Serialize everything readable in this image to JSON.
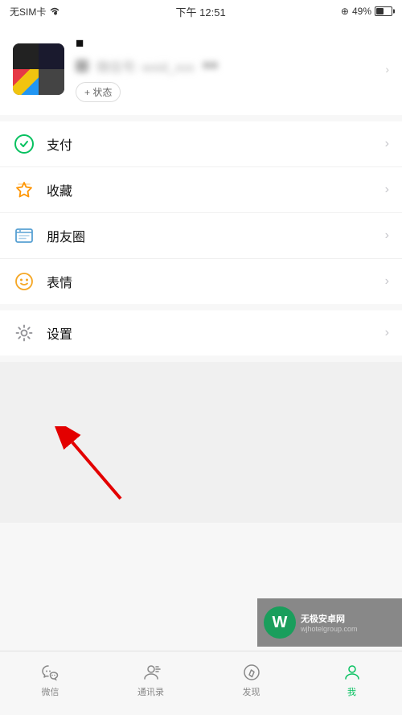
{
  "statusBar": {
    "left": "无SIM卡",
    "wifi": "wifi",
    "time": "下午 12:51",
    "lock": "⊕",
    "battery": "49%"
  },
  "profile": {
    "name": "■",
    "statusBtn": "+ 状态",
    "blurredText": "微信号"
  },
  "menu": {
    "items": [
      {
        "id": "pay",
        "label": "支付",
        "icon": "pay"
      },
      {
        "id": "favorites",
        "label": "收藏",
        "icon": "favorites"
      },
      {
        "id": "moments",
        "label": "朋友圈",
        "icon": "moments"
      },
      {
        "id": "stickers",
        "label": "表情",
        "icon": "stickers"
      },
      {
        "id": "settings",
        "label": "设置",
        "icon": "settings"
      }
    ]
  },
  "bottomNav": {
    "items": [
      {
        "id": "wechat",
        "label": "微信",
        "active": false
      },
      {
        "id": "contacts",
        "label": "通讯录",
        "active": false
      },
      {
        "id": "discover",
        "label": "发现",
        "active": false
      },
      {
        "id": "me",
        "label": "我",
        "active": true
      }
    ]
  },
  "watermark": {
    "logo": "W",
    "line1": "无极安卓网",
    "line2": "wjhotelgroup.com"
  }
}
